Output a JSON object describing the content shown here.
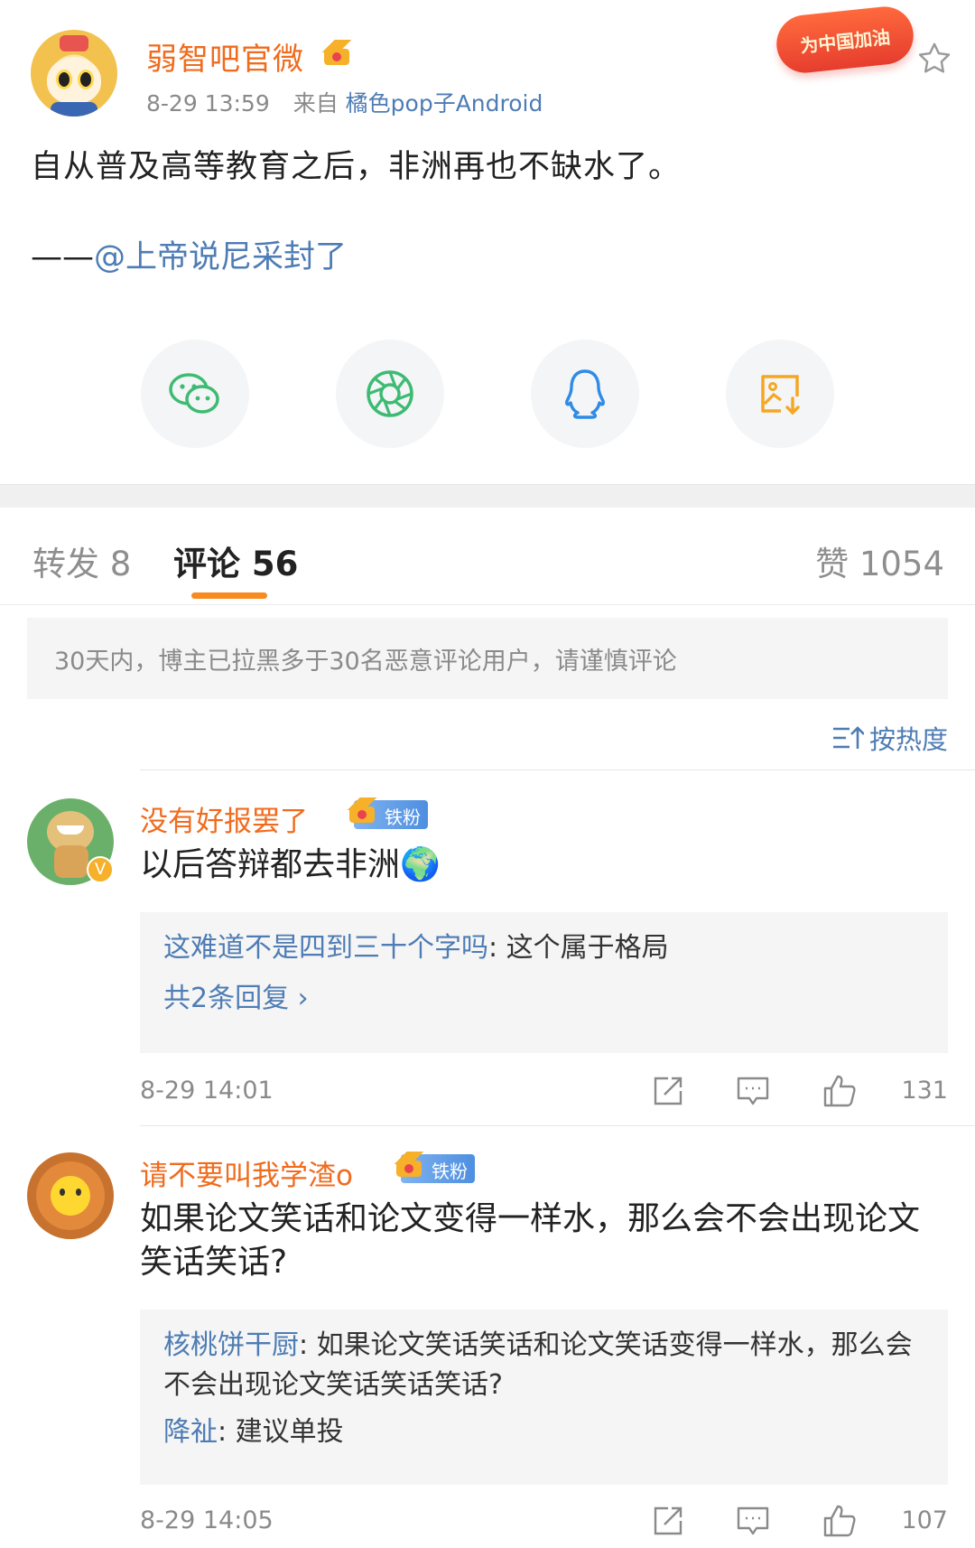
{
  "post": {
    "author": "弱智吧官微",
    "time": "8-29 13:59",
    "source_prefix": "来自",
    "source": "橘色pop子Android",
    "badge_text": "为中国加油",
    "text": "自从普及高等教育之后，非洲再也不缺水了。",
    "quote_prefix": "——",
    "quote_mention": "@上帝说尼采封了"
  },
  "share": [
    "wechat-icon",
    "moments-icon",
    "qq-icon",
    "save-image-icon"
  ],
  "tabs": {
    "repost": "转发 8",
    "comments": "评论 56",
    "likes": "赞 1054"
  },
  "notice": "30天内，博主已拉黑多于30名恶意评论用户，请谨慎评论",
  "sort_label": "按热度",
  "comments": [
    {
      "name": "没有好报罢了",
      "fan_badge": "铁粉",
      "text": "以后答辩都去非洲🌍",
      "replies": [
        {
          "who": "这难道不是四到三十个字吗",
          "text": ": 这个属于格局"
        }
      ],
      "more_replies": "共2条回复 ›",
      "time": "8-29 14:01",
      "likes": "131"
    },
    {
      "name": "请不要叫我学渣o",
      "fan_badge": "铁粉",
      "text": "如果论文笑话和论文变得一样水，那么会不会出现论文笑话笑话?",
      "replies": [
        {
          "who": "核桃饼干厨",
          "text": ": 如果论文笑话笑话和论文笑话变得一样水，那么会不会出现论文笑话笑话笑话?"
        },
        {
          "who": "降祉",
          "text": ": 建议单投"
        }
      ],
      "time": "8-29 14:05",
      "likes": "107"
    }
  ],
  "colors": {
    "accent_orange": "#f06b1d",
    "link_blue": "#4e7cb4",
    "tab_indicator": "#f78b1f"
  }
}
